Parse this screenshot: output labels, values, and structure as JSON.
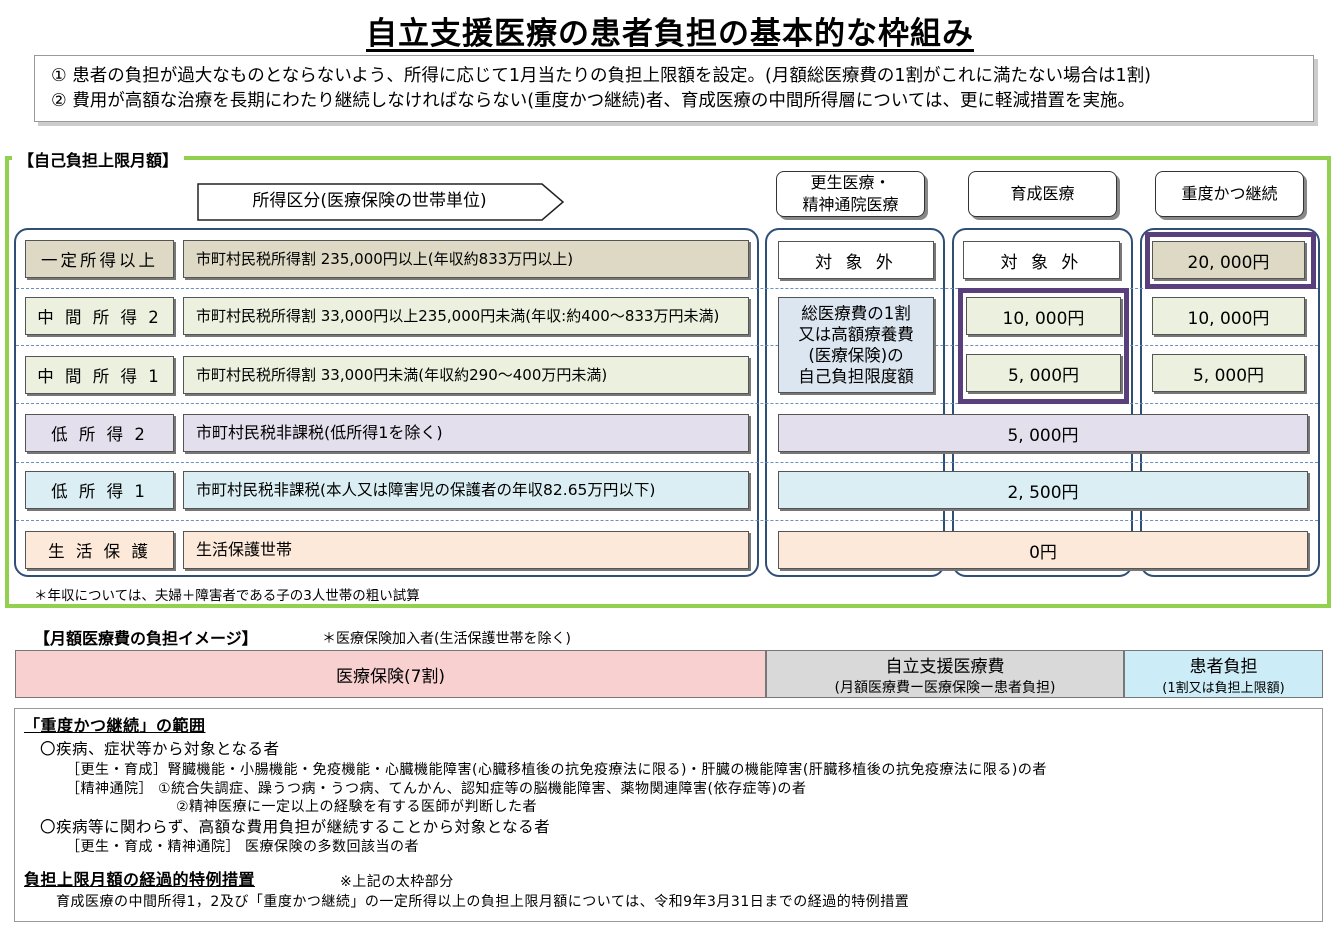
{
  "title": "自立支援医療の患者負担の基本的な枠組み",
  "intro": {
    "line1": "①  患者の負担が過大なものとならないよう、所得に応じて1月当たりの負担上限額を設定。(月額総医療費の1割がこれに満たない場合は1割)",
    "line2": "②  費用が高額な治療を長期にわたり継続しなければならない(重度かつ継続)者、育成医療の中間所得層については、更に軽減措置を実施。"
  },
  "limit_section": {
    "label": "【自己負担上限月額】",
    "income_header": "所得区分(医療保険の世帯単位)",
    "col_rehab": "更生医療・\n精神通院医療",
    "col_ikusei": "育成医療",
    "col_severe": "重度かつ継続",
    "rows": [
      {
        "label": "一定所得以上",
        "desc": "市町村民税所得割  235,000円以上(年収約833万円以上)",
        "rehab": "対 象 外",
        "ikusei": "対 象 外",
        "severe": "20, 000円"
      },
      {
        "label": "中 間 所 得 2",
        "desc": "市町村民税所得割  33,000円以上235,000円未満(年収:約400～833万円未満)",
        "ikusei": "10, 000円",
        "severe": "10, 000円"
      },
      {
        "label": "中 間 所 得 1",
        "desc": "市町村民税所得割  33,000円未満(年収約290～400万円未満)",
        "ikusei": "5, 000円",
        "severe": "5, 000円"
      },
      {
        "label": "低 所 得 2",
        "desc": "市町村民税非課税(低所得1を除く)",
        "merged": "5, 000円"
      },
      {
        "label": "低 所 得 1",
        "desc": "市町村民税非課税(本人又は障害児の保護者の年収82.65万円以下)",
        "merged": "2, 500円"
      },
      {
        "label": "生 活 保 護",
        "desc": "生活保護世帯",
        "merged": "0円"
      }
    ],
    "rehab_middle": "総医療費の1割\n又は高額療養費\n(医療保険)の\n自己負担限度額",
    "footnote": "＊年収については、夫婦＋障害者である子の3人世帯の粗い試算"
  },
  "image_section": {
    "title": "【月額医療費の負担イメージ】",
    "subtitle": "＊医療保険加入者(生活保護世帯を除く)",
    "insurance": "医療保険(7割)",
    "support_title": "自立支援医療費",
    "support_sub": "(月額医療費ー医療保険ー患者負担)",
    "patient_title": "患者負担",
    "patient_sub": "(1割又は負担上限額)"
  },
  "scope": {
    "heading": "「重度かつ継続」の範囲",
    "b1": "〇疾病、症状等から対象となる者",
    "b1_l1": "［更生・育成］腎臓機能・小腸機能・免疫機能・心臓機能障害(心臓移植後の抗免疫療法に限る)・肝臓の機能障害(肝臓移植後の抗免疫療法に限る)の者",
    "b1_l2": "［精神通院］   ①統合失調症、躁うつ病・うつ病、てんかん、認知症等の脳機能障害、薬物関連障害(依存症等)の者",
    "b1_l3": "②精神医療に一定以上の経験を有する医師が判断した者",
    "b2": "〇疾病等に関わらず、高額な費用負担が継続することから対象となる者",
    "b2_l1": "［更生・育成・精神通院］   医療保険の多数回該当の者",
    "heading2": "負担上限月額の経過的特例措置",
    "heading2_note": "※上記の太枠部分",
    "transitional": "育成医療の中間所得1，2及び「重度かつ継続」の一定所得以上の負担上限月額については、令和9年3月31日までの経過的特例措置"
  },
  "colors": {
    "green": "#92d050",
    "navy": "#2f4f76",
    "purple": "#5a3f7d",
    "row_high": "#ddd9c4",
    "row_mid": "#ebf1de",
    "row_low2": "#e4dfec",
    "row_low1": "#daeef3",
    "row_welfare": "#fde9d9",
    "rehab_mid": "#dce6f1",
    "bar_ins": "#f9d0d0",
    "bar_sup": "#d9d9d9",
    "bar_pat": "#ccecf7"
  }
}
